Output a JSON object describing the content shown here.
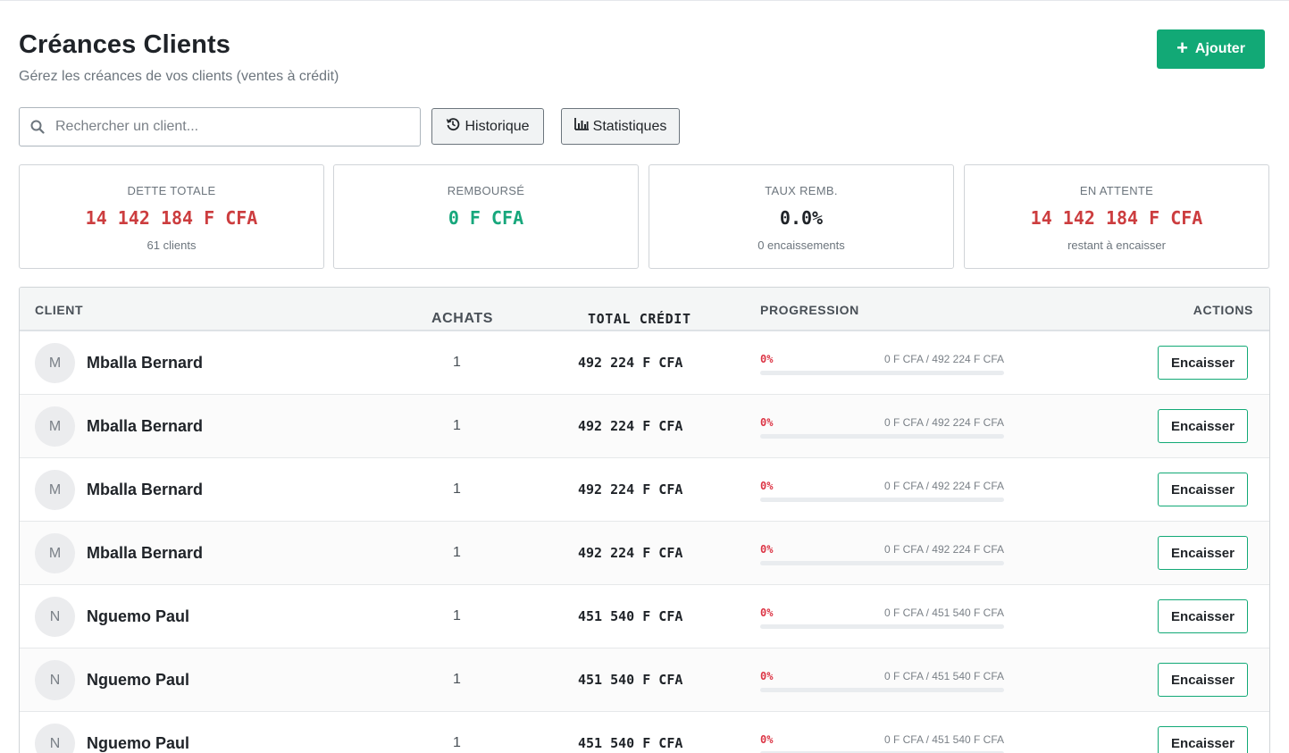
{
  "header": {
    "title": "Créances Clients",
    "subtitle": "Gérez les créances de vos clients (ventes à crédit)",
    "add_label": "Ajouter"
  },
  "toolbar": {
    "search_placeholder": "Rechercher un client...",
    "history_label": "Historique",
    "stats_label": "Statistiques"
  },
  "colors": {
    "accent": "#12a976",
    "debt_red": "#cc3d3f",
    "repaid_green": "#17a77c"
  },
  "cards": [
    {
      "label": "DETTE TOTALE",
      "value": "14 142 184 F CFA",
      "sub": "61 clients"
    },
    {
      "label": "REMBOURSÉ",
      "value": "0 F CFA",
      "sub": ""
    },
    {
      "label": "TAUX REMB.",
      "value": "0.0%",
      "sub": "0 encaissements"
    },
    {
      "label": "EN ATTENTE",
      "value": "14 142 184 F CFA",
      "sub": "restant à encaisser"
    }
  ],
  "table": {
    "columns": [
      "CLIENT",
      "ACHATS",
      "TOTAL CRÉDIT",
      "PROGRESSION",
      "ACTIONS"
    ],
    "action_label": "Encaisser",
    "rows": [
      {
        "initial": "M",
        "name": "Mballa Bernard",
        "achats": "1",
        "total": "492 224 F CFA",
        "pct": "0%",
        "progress": 0,
        "amounts": "0 F CFA / 492 224 F CFA"
      },
      {
        "initial": "M",
        "name": "Mballa Bernard",
        "achats": "1",
        "total": "492 224 F CFA",
        "pct": "0%",
        "progress": 0,
        "amounts": "0 F CFA / 492 224 F CFA"
      },
      {
        "initial": "M",
        "name": "Mballa Bernard",
        "achats": "1",
        "total": "492 224 F CFA",
        "pct": "0%",
        "progress": 0,
        "amounts": "0 F CFA / 492 224 F CFA"
      },
      {
        "initial": "M",
        "name": "Mballa Bernard",
        "achats": "1",
        "total": "492 224 F CFA",
        "pct": "0%",
        "progress": 0,
        "amounts": "0 F CFA / 492 224 F CFA"
      },
      {
        "initial": "N",
        "name": "Nguemo Paul",
        "achats": "1",
        "total": "451 540 F CFA",
        "pct": "0%",
        "progress": 0,
        "amounts": "0 F CFA / 451 540 F CFA"
      },
      {
        "initial": "N",
        "name": "Nguemo Paul",
        "achats": "1",
        "total": "451 540 F CFA",
        "pct": "0%",
        "progress": 0,
        "amounts": "0 F CFA / 451 540 F CFA"
      },
      {
        "initial": "N",
        "name": "Nguemo Paul",
        "achats": "1",
        "total": "451 540 F CFA",
        "pct": "0%",
        "progress": 0,
        "amounts": "0 F CFA / 451 540 F CFA"
      }
    ]
  }
}
